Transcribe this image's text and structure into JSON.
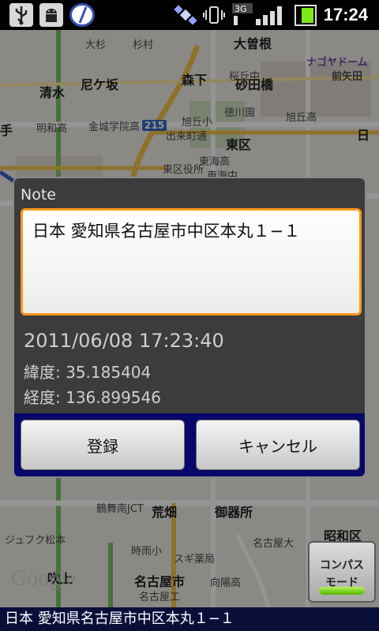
{
  "status_bar": {
    "time": "17:24",
    "network_label": "3G",
    "icons": [
      "usb-icon",
      "android-icon",
      "compass-app-icon",
      "satellite-icon",
      "vibrate-icon",
      "signal-3g-icon",
      "battery-icon"
    ]
  },
  "map": {
    "labels": [
      "大曽根",
      "ナゴヤドーム",
      "前矢田",
      "大杉",
      "杉村",
      "清水",
      "尼ケ坂",
      "森下",
      "砂田橋",
      "桜丘中",
      "手",
      "明和高",
      "金城学院高",
      "旭丘小",
      "徳川園",
      "旭丘高",
      "東区",
      "出来町通",
      "東区役所",
      "東海高",
      "東海中",
      "215",
      "荒畑",
      "御器所",
      "昭和区",
      "鶴舞南JCT",
      "名古屋市",
      "名古屋工",
      "スギ薬局",
      "向陽高",
      "名古屋大",
      "時雨小",
      "ジュフク松本",
      "吹上",
      "日"
    ],
    "logo": "Google"
  },
  "compass_mode": {
    "label_line1": "コンパス",
    "label_line2": "モード",
    "indicator_color": "#54b800"
  },
  "dialog": {
    "title": "Note",
    "note_value": "日本 愛知県名古屋市中区本丸１−１",
    "datetime": "2011/06/08 17:23:40",
    "latitude": "緯度: 35.185404",
    "longitude": "経度: 136.899546",
    "register_label": "登録",
    "cancel_label": "キャンセル"
  },
  "address_bar": {
    "text": "日本 愛知県名古屋市中区本丸１−１"
  },
  "colors": {
    "focus_border": "#ff9a1a",
    "button_bar": "#08086a",
    "address_bar": "#0a0f3a"
  }
}
